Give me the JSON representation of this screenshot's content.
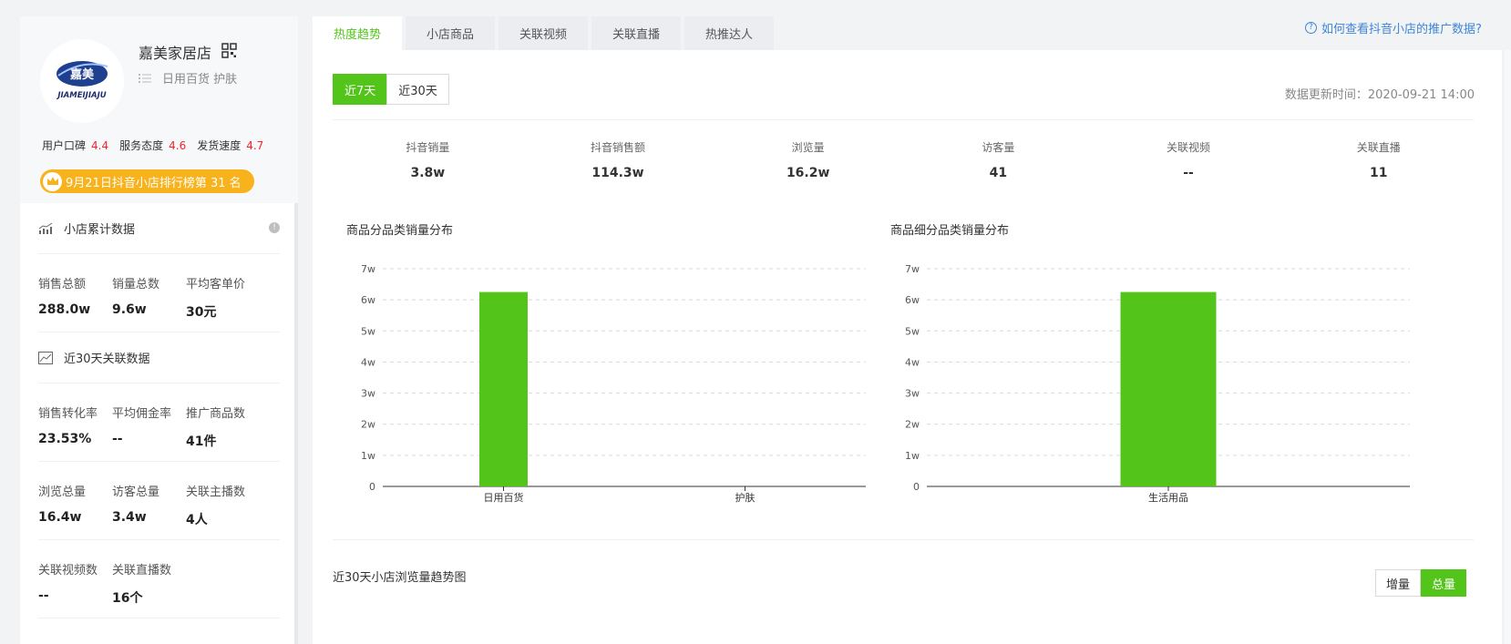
{
  "shop": {
    "name": "嘉美家居店",
    "tags": "日用百货 护肤",
    "logo_text_top": "嘉美",
    "logo_text_bottom": "JIAMEIJIAJU",
    "ratings": [
      {
        "label": "用户口碑",
        "value": "4.4"
      },
      {
        "label": "服务态度",
        "value": "4.6"
      },
      {
        "label": "发货速度",
        "value": "4.7"
      }
    ],
    "rank_badge": "9月21日抖音小店排行榜第 31 名"
  },
  "cumulative": {
    "title": "小店累计数据",
    "stats": [
      {
        "label": "销售总额",
        "value": "288.0w"
      },
      {
        "label": "销量总数",
        "value": "9.6w"
      },
      {
        "label": "平均客单价",
        "value": "30元"
      }
    ]
  },
  "recent30": {
    "title": "近30天关联数据",
    "rows": [
      [
        {
          "label": "销售转化率",
          "value": "23.53%"
        },
        {
          "label": "平均佣金率",
          "value": "--"
        },
        {
          "label": "推广商品数",
          "value": "41件"
        }
      ],
      [
        {
          "label": "浏览总量",
          "value": "16.4w"
        },
        {
          "label": "访客总量",
          "value": "3.4w"
        },
        {
          "label": "关联主播数",
          "value": "4人"
        }
      ],
      [
        {
          "label": "关联视频数",
          "value": "--"
        },
        {
          "label": "关联直播数",
          "value": "16个"
        }
      ]
    ]
  },
  "tabs": [
    "热度趋势",
    "小店商品",
    "关联视频",
    "关联直播",
    "热推达人"
  ],
  "help_link": "如何查看抖音小店的推广数据?",
  "range_buttons": [
    "近7天",
    "近30天"
  ],
  "update_time": "数据更新时间：2020-09-21 14:00",
  "metrics": [
    {
      "label": "抖音销量",
      "value": "3.8w"
    },
    {
      "label": "抖音销售额",
      "value": "114.3w"
    },
    {
      "label": "浏览量",
      "value": "16.2w"
    },
    {
      "label": "访客量",
      "value": "41"
    },
    {
      "label": "关联视频",
      "value": "--"
    },
    {
      "label": "关联直播",
      "value": "11"
    }
  ],
  "chart_data": [
    {
      "type": "bar",
      "title": "商品分品类销量分布",
      "categories": [
        "日用百货",
        "护肤"
      ],
      "values": [
        62500,
        0
      ],
      "y_ticks": [
        "0",
        "1w",
        "2w",
        "3w",
        "4w",
        "5w",
        "6w",
        "7w"
      ],
      "ylim": [
        0,
        70000
      ],
      "grid": true,
      "color": "#52c41a"
    },
    {
      "type": "bar",
      "title": "商品细分品类销量分布",
      "categories": [
        "生活用品"
      ],
      "values": [
        62500
      ],
      "y_ticks": [
        "0",
        "1w",
        "2w",
        "3w",
        "4w",
        "5w",
        "6w",
        "7w"
      ],
      "ylim": [
        0,
        70000
      ],
      "grid": true,
      "color": "#52c41a"
    }
  ],
  "trend": {
    "title": "近30天小店浏览量趋势图",
    "toggle": [
      "增量",
      "总量"
    ]
  },
  "colors": {
    "accent": "#52c41a",
    "rating": "#f5222d",
    "badge": "#f8b21c",
    "link": "#3e85d8"
  }
}
